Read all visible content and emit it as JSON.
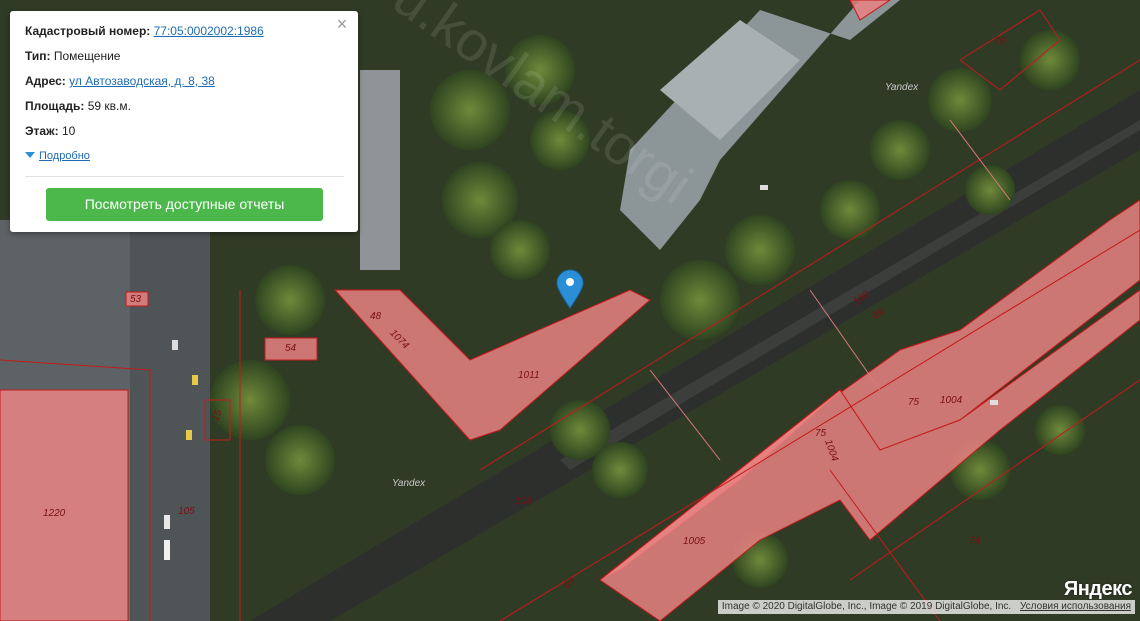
{
  "popup": {
    "cadastral_label": "Кадастровый номер:",
    "cadastral_number": "77:05:0002002:1986",
    "type_label": "Тип:",
    "type_value": "Помещение",
    "address_label": "Адрес:",
    "address_value": "ул Автозаводская, д. 8, 38",
    "area_label": "Площадь:",
    "area_value": "59 кв.м.",
    "floor_label": "Этаж:",
    "floor_value": "10",
    "details_link": "Подробно",
    "reports_button": "Посмотреть доступные отчеты",
    "close_icon": "×"
  },
  "map": {
    "parcel_labels": [
      "79",
      "53",
      "54",
      "48",
      "1011",
      "1074",
      "15",
      "105",
      "1220",
      "108",
      "108",
      "69",
      "75",
      "75",
      "1004",
      "1004",
      "1005",
      "74",
      "69"
    ],
    "yandex_labels": [
      "Yandex",
      "Yandex"
    ],
    "watermark": "ru.kovlam.torgi",
    "logo": "Яндекс",
    "copyright": "Image © 2020 DigitalGlobe, Inc., Image © 2019 DigitalGlobe, Inc.",
    "terms_link": "Условия использования",
    "colors": {
      "parcel_fill": "#e98383",
      "parcel_stroke": "#c41a1a",
      "marker": "#2a8fd6",
      "button": "#4cb84c"
    },
    "marker_icon": "location-pin-icon"
  }
}
